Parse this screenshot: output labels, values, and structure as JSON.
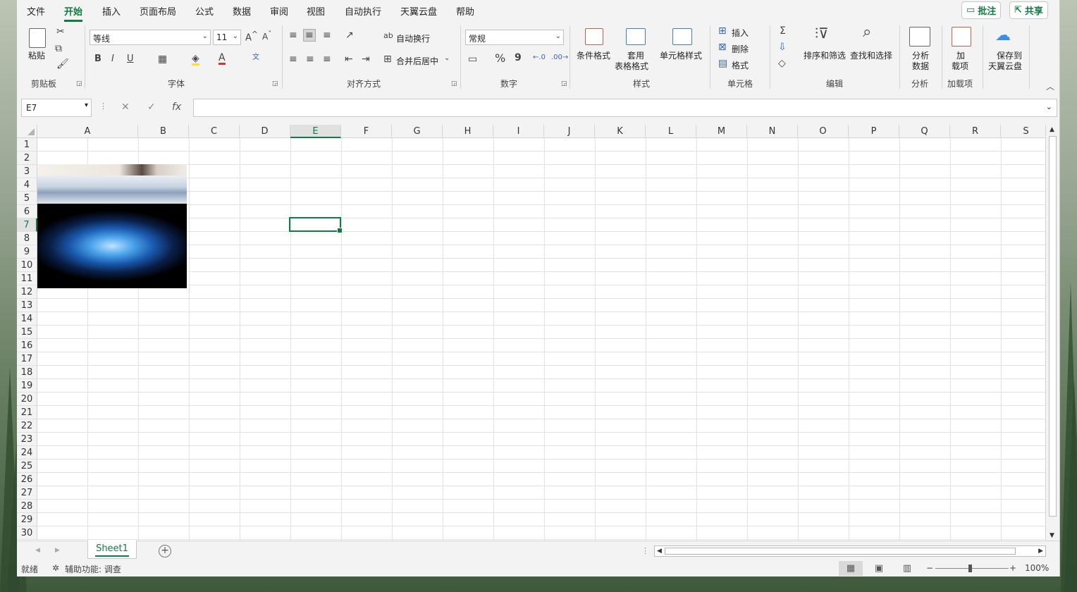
{
  "menu": {
    "tabs": [
      "文件",
      "开始",
      "插入",
      "页面布局",
      "公式",
      "数据",
      "审阅",
      "视图",
      "自动执行",
      "天翼云盘",
      "帮助"
    ],
    "active": "开始",
    "comment_btn": "批注",
    "share_btn": "共享"
  },
  "ribbon": {
    "clipboard": {
      "paste": "粘贴",
      "label": "剪贴板"
    },
    "font": {
      "name": "等线",
      "size": "11",
      "label": "字体",
      "bold": "B",
      "italic": "I",
      "underline": "U"
    },
    "alignment": {
      "wrap": "自动换行",
      "merge": "合并后居中",
      "label": "对齐方式"
    },
    "number": {
      "format": "常规",
      "label": "数字",
      "percent": "%",
      "comma": "9"
    },
    "styles": {
      "conditional": "条件格式",
      "table1": "套用",
      "table2": "表格格式",
      "cell_style": "单元格样式",
      "label": "样式"
    },
    "cells": {
      "insert": "插入",
      "delete": "删除",
      "format": "格式",
      "label": "单元格"
    },
    "editing": {
      "sort": "排序和筛选",
      "find": "查找和选择",
      "label": "编辑"
    },
    "analysis": {
      "analyze1": "分析",
      "analyze2": "数据",
      "label": "分析"
    },
    "addins": {
      "add1": "加",
      "add2": "载项",
      "label": "加载项"
    },
    "cloud": {
      "save1": "保存到",
      "save2": "天翼云盘"
    }
  },
  "formula_bar": {
    "name_box": "E7",
    "fx": "fx",
    "value": ""
  },
  "grid": {
    "columns": [
      "A",
      "B",
      "C",
      "D",
      "E",
      "F",
      "G",
      "H",
      "I",
      "J",
      "K",
      "L",
      "M",
      "N",
      "O",
      "P",
      "Q",
      "R",
      "S"
    ],
    "rows": [
      "1",
      "2",
      "3",
      "4",
      "5",
      "6",
      "7",
      "8",
      "9",
      "10",
      "11",
      "12",
      "13",
      "14",
      "15",
      "16",
      "17",
      "18",
      "19",
      "20",
      "21",
      "22",
      "23",
      "24",
      "25",
      "26",
      "27",
      "28",
      "29",
      "30"
    ],
    "selected_cell": "E7",
    "selected_col": "E",
    "selected_row": "7"
  },
  "sheets": {
    "active": "Sheet1"
  },
  "status": {
    "ready": "就绪",
    "accessibility": "辅助功能: 调查",
    "zoom": "100%"
  },
  "colors": {
    "accent": "#107c41"
  }
}
